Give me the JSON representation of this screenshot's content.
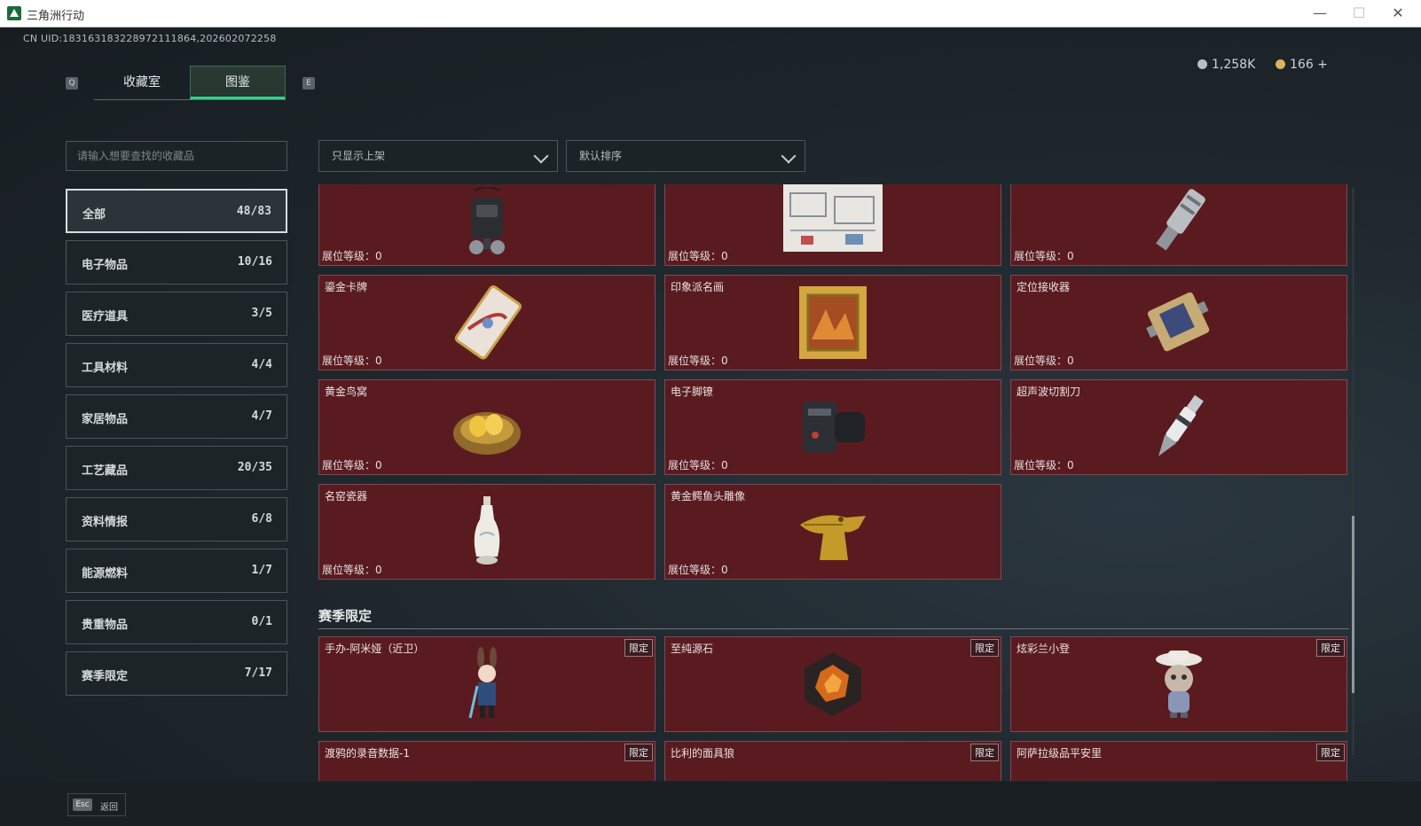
{
  "window": {
    "title": "三角洲行动",
    "minimize": "—",
    "maximize": "☐",
    "close": "✕"
  },
  "header": {
    "uid": "CN UID:183163183228972111864,202602072258",
    "key_left": "Q",
    "key_right": "E",
    "tabs": [
      {
        "label": "收藏室",
        "active": false
      },
      {
        "label": "图鉴",
        "active": true
      }
    ],
    "currency": [
      {
        "value": "1,258K",
        "color": "#b9bec1"
      },
      {
        "value": "166 +",
        "color": "#d8b35a"
      }
    ]
  },
  "search": {
    "placeholder": "请输入想要查找的收藏品"
  },
  "filters": {
    "shelf_filter": "只显示上架",
    "sort": "默认排序"
  },
  "categories": [
    {
      "label": "全部",
      "count": "48/83",
      "active": true
    },
    {
      "label": "电子物品",
      "count": "10/16"
    },
    {
      "label": "医疗道具",
      "count": "3/5"
    },
    {
      "label": "工具材料",
      "count": "4/4"
    },
    {
      "label": "家居物品",
      "count": "4/7"
    },
    {
      "label": "工艺藏品",
      "count": "20/35"
    },
    {
      "label": "资料情报",
      "count": "6/8"
    },
    {
      "label": "能源燃料",
      "count": "1/7"
    },
    {
      "label": "贵重物品",
      "count": "0/1"
    },
    {
      "label": "赛季限定",
      "count": "7/17"
    }
  ],
  "level_label": "展位等级：",
  "level_value": "0",
  "items": [
    {
      "name": "",
      "icon": "device-backpack-icon"
    },
    {
      "name": "",
      "icon": "blueprint-map-icon"
    },
    {
      "name": "",
      "icon": "flashlight-tool-icon"
    },
    {
      "name": "鎏金卡牌",
      "icon": "gilded-card-icon"
    },
    {
      "name": "印象派名画",
      "icon": "framed-painting-icon"
    },
    {
      "name": "定位接收器",
      "icon": "gps-receiver-icon"
    },
    {
      "name": "黄金鸟窝",
      "icon": "golden-nest-icon"
    },
    {
      "name": "电子脚镣",
      "icon": "ankle-monitor-icon"
    },
    {
      "name": "超声波切割刀",
      "icon": "ultrasonic-cutter-icon"
    },
    {
      "name": "名窑瓷器",
      "icon": "porcelain-vase-icon"
    },
    {
      "name": "黄金鳄鱼头雕像",
      "icon": "golden-crocodile-icon"
    }
  ],
  "season_section": {
    "title": "赛季限定",
    "badge": "限定"
  },
  "season_items": [
    {
      "name": "手办-阿米娅（近卫）",
      "icon": "amiya-figure-icon"
    },
    {
      "name": "至纯源石",
      "icon": "originium-crystal-icon"
    },
    {
      "name": "炫彩兰小登",
      "icon": "plush-figure-icon"
    }
  ],
  "season_items_partial": [
    {
      "name": "渡鸦的录音数据-1"
    },
    {
      "name": "比利的面具狼"
    },
    {
      "name": "阿萨拉级品平安里"
    }
  ],
  "footer": {
    "esc_key": "Esc",
    "esc_label": "返回"
  }
}
